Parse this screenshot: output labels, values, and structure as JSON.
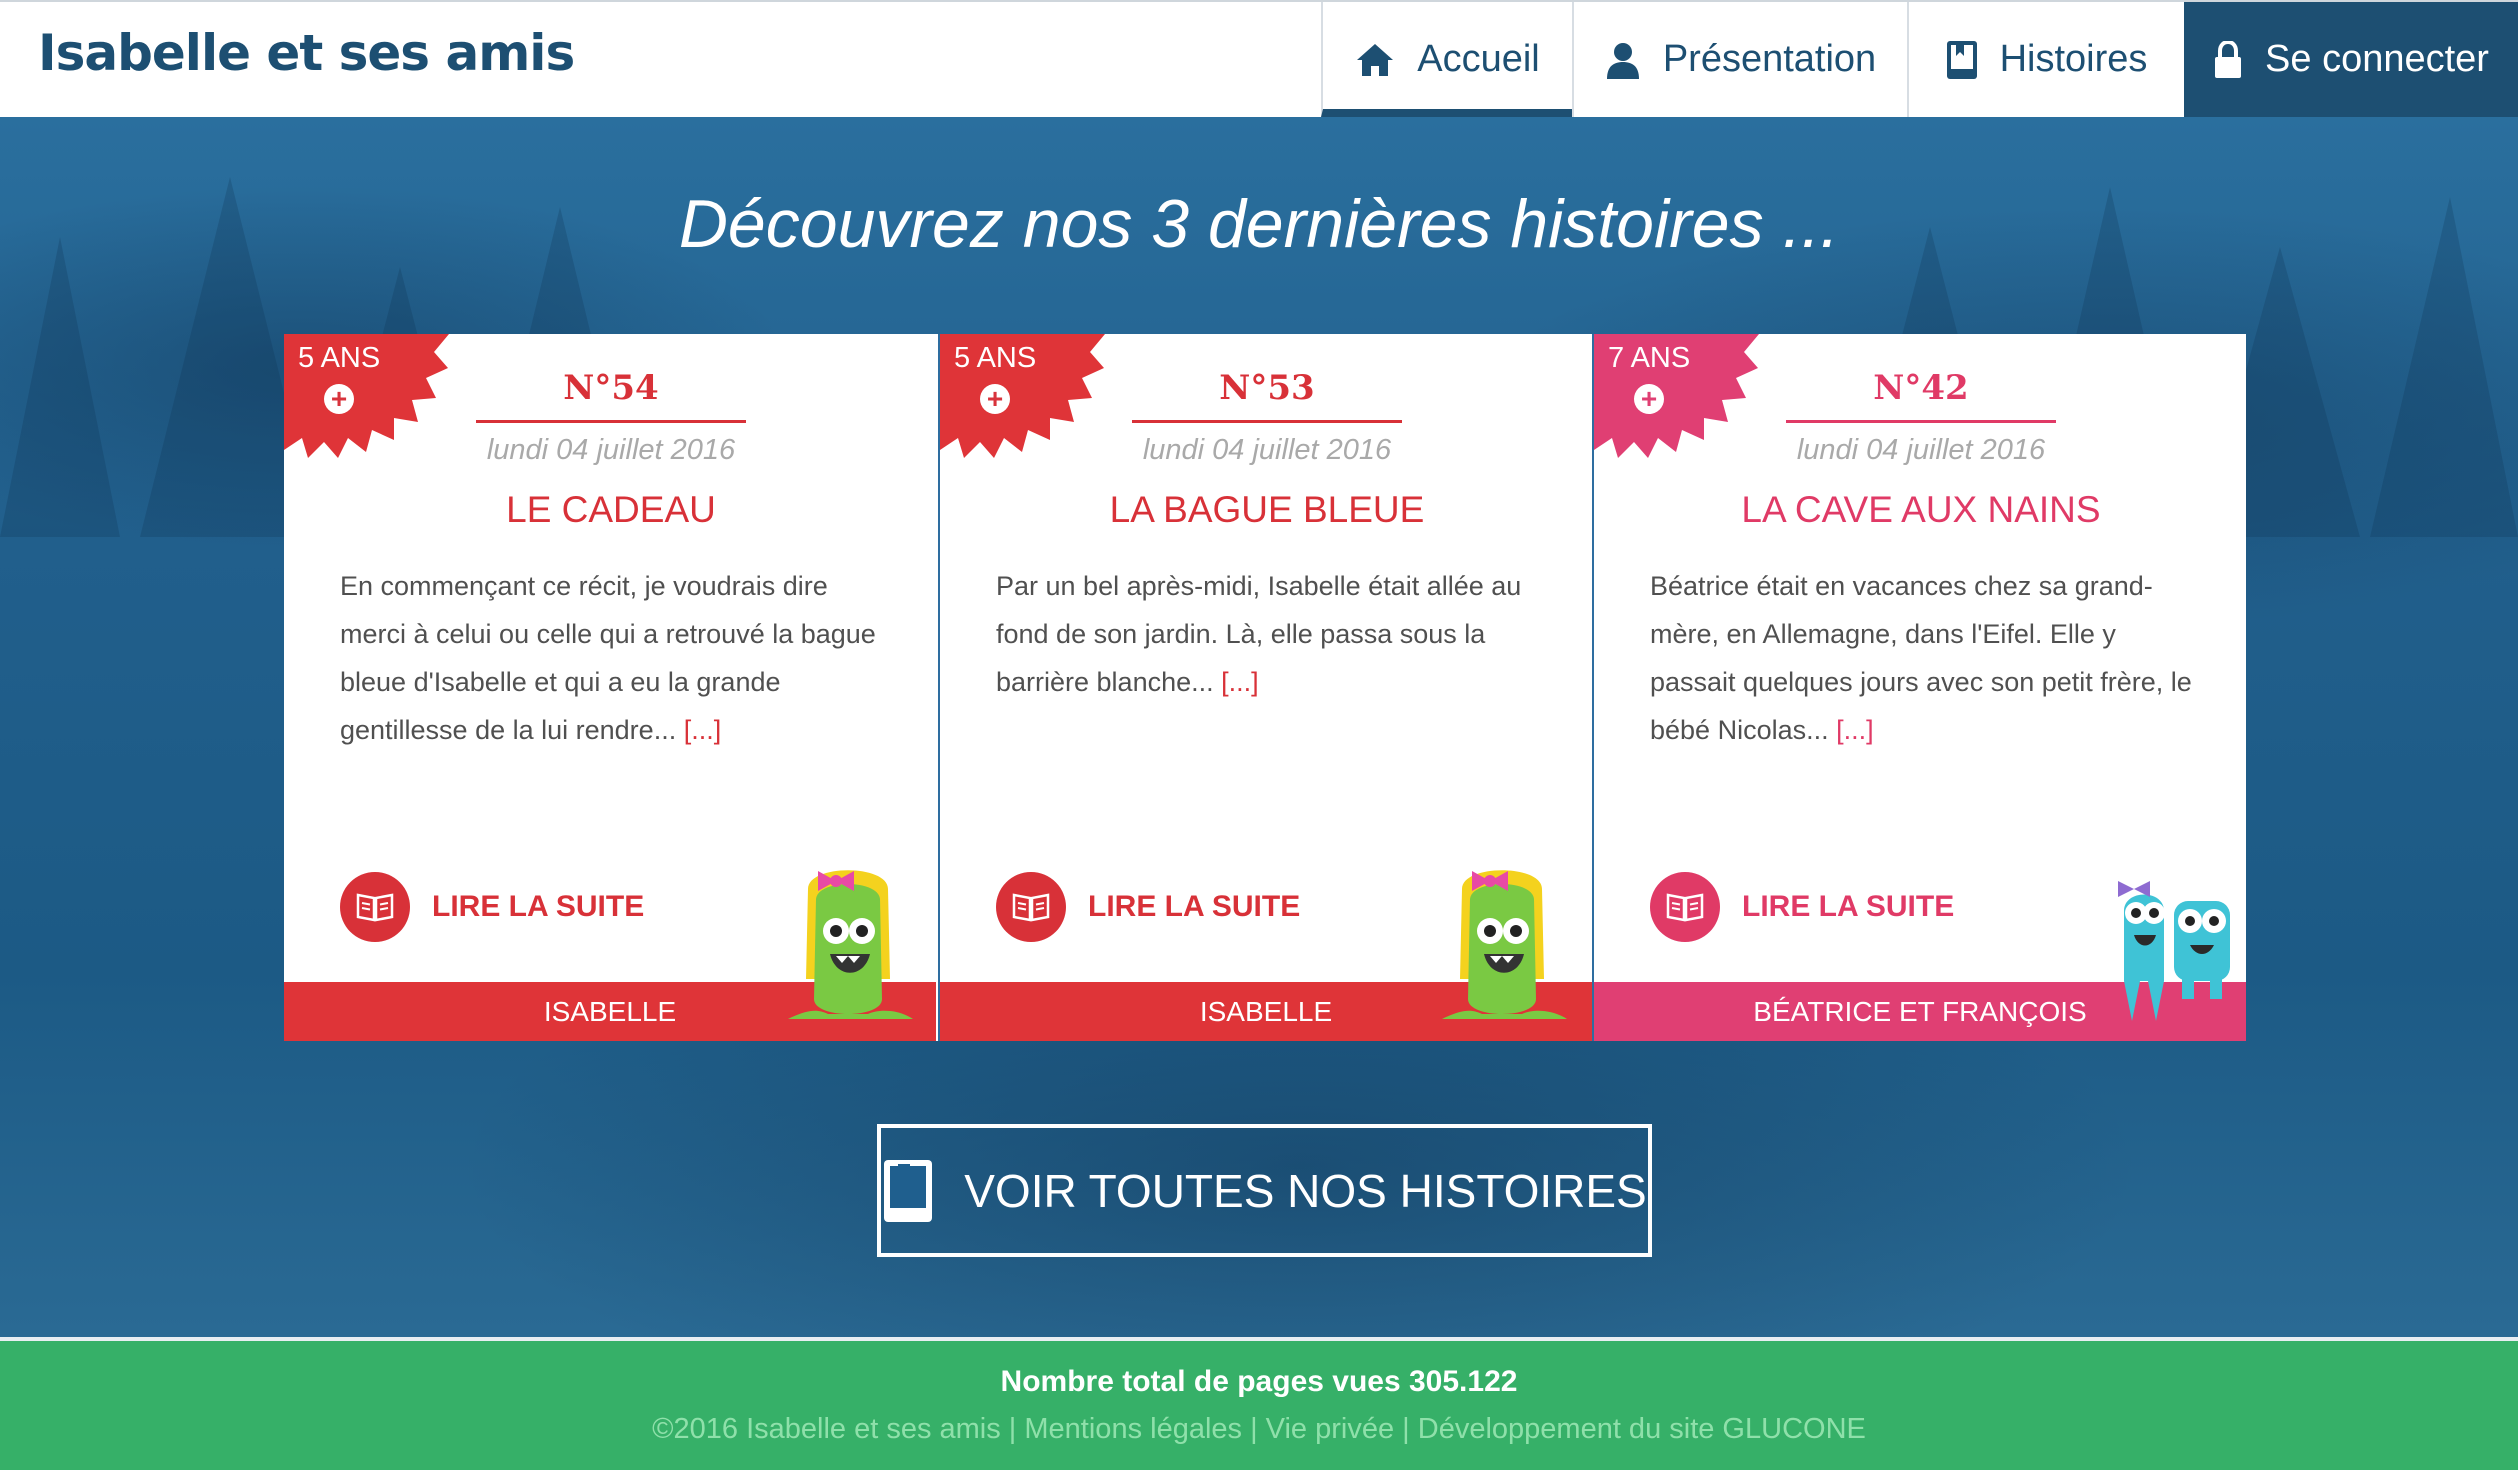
{
  "site": {
    "logo": "Isabelle et ses amis"
  },
  "nav": {
    "items": [
      {
        "label": "Accueil",
        "icon": "home-icon",
        "active": true
      },
      {
        "label": "Présentation",
        "icon": "user-icon",
        "active": false
      },
      {
        "label": "Histoires",
        "icon": "book-icon",
        "active": false
      },
      {
        "label": "Se connecter",
        "icon": "lock-icon",
        "active": false
      }
    ]
  },
  "hero": {
    "headline": "Découvrez nos 3 dernières histoires ..."
  },
  "stories": [
    {
      "age": "5 ANS",
      "number": "N°54",
      "date": "lundi 04 juillet 2016",
      "title": "LE CADEAU",
      "excerpt": "En commençant ce récit, je voudrais dire merci à celui ou celle qui a retrouvé la bague bleue d'Isabelle et qui a eu la grande gentillesse de la lui rendre...",
      "more": "[...]",
      "read_label": "LIRE LA SUITE",
      "author": "ISABELLE",
      "mascot": "isabelle-mascot-icon",
      "color": "#df3438"
    },
    {
      "age": "5 ANS",
      "number": "N°53",
      "date": "lundi 04 juillet 2016",
      "title": "LA BAGUE BLEUE",
      "excerpt": "Par un bel après-midi, Isabelle était allée au fond de son jardin. Là, elle passa sous la barrière blanche...",
      "more": "[...]",
      "read_label": "LIRE LA SUITE",
      "author": "ISABELLE",
      "mascot": "isabelle-mascot-icon",
      "color": "#df3438"
    },
    {
      "age": "7 ANS",
      "number": "N°42",
      "date": "lundi 04 juillet 2016",
      "title": "LA CAVE AUX NAINS",
      "excerpt": "Béatrice était en vacances chez sa grand-mère, en Allemagne, dans l'Eifel. Elle y passait quelques jours avec son petit frère, le bébé Nicolas...",
      "more": "[...]",
      "read_label": "LIRE LA SUITE",
      "author": "BÉATRICE ET FRANÇOIS",
      "mascot": "beatrice-francois-mascot-icon",
      "color": "#e03f73"
    }
  ],
  "cta": {
    "label": "VOIR TOUTES NOS HISTOIRES",
    "icon": "book-icon"
  },
  "footer": {
    "views": "Nombre total de pages vues 305.122",
    "links": "©2016 Isabelle et ses amis | Mentions légales | Vie privée | Développement du site GLUCONE"
  },
  "colors": {
    "brand": "#1d4f72",
    "red": "#df3438",
    "pink": "#e03f73",
    "footer": "#36b068"
  }
}
